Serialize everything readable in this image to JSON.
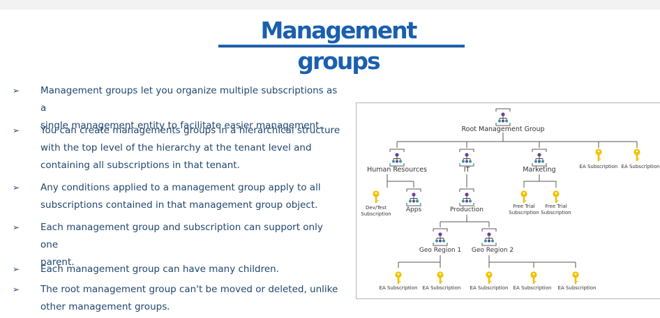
{
  "slide": {
    "title": "Management groups",
    "bullets": [
      {
        "lines": [
          "Management groups let you organize multiple subscriptions as a",
          "single management entity to facilitate easier management."
        ]
      },
      {
        "lines": [
          "You can create managements groups in a hierarchical structure",
          "with the top level of the hierarchy at the tenant level and",
          "containing all subscriptions in that tenant."
        ]
      },
      {
        "lines": [
          "Any conditions applied to a management group apply to all",
          "subscriptions contained in that management group object."
        ]
      },
      {
        "lines": [
          "Each management group and subscription can support only one",
          "parent."
        ]
      },
      {
        "lines": [
          "Each management group can have many children."
        ]
      },
      {
        "lines": [
          "The root management group can't be moved or deleted, unlike",
          "other management groups."
        ]
      }
    ],
    "bullet_glyph": "➢"
  },
  "diagram": {
    "nodes": {
      "root": "Root Management Group",
      "hr": "Human Resources",
      "it": "IT",
      "marketing": "Marketing",
      "ea_sub_top_1": "EA Subscription",
      "ea_sub_top_2": "EA Subscription",
      "devtest_line1": "Dev/Test",
      "devtest_line2": "Subscription",
      "apps": "Apps",
      "production": "Production",
      "free_trial_1_line1": "Free Trial",
      "free_trial_1_line2": "Subscription",
      "free_trial_2_line1": "Free Trial",
      "free_trial_2_line2": "Subscription",
      "geo1": "Geo Region 1",
      "geo2": "Geo Region 2",
      "ea_bottom": [
        "EA Subscription",
        "EA Subscription",
        "EA Subscription",
        "EA Subscription",
        "EA Subscription"
      ]
    },
    "colors": {
      "key_gold": "#f2c200",
      "mg_purple": "#6b3fa0",
      "mg_teal": "#2a9d8f",
      "connector": "#555555"
    },
    "icons": {
      "management_group": "management-group-icon",
      "subscription": "subscription-key-icon"
    }
  }
}
